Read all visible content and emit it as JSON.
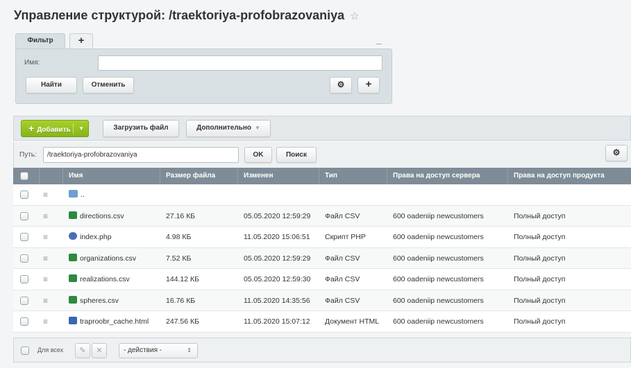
{
  "title": "Управление структурой: /traektoriya-profobrazovaniya",
  "icons": {
    "favorite": "star-icon",
    "settings": "gear-icon",
    "add": "plus-icon",
    "row_menu": "hamburger-icon",
    "edit": "pencil-icon",
    "delete": "close-icon"
  },
  "filter": {
    "tab_label": "Фильтр",
    "add_tab": "+",
    "collapse": "–",
    "name_label": "Имя:",
    "name_value": "",
    "find_label": "Найти",
    "cancel_label": "Отменить",
    "gear": "⚙",
    "plus": "+"
  },
  "toolbar": {
    "add_label": "Добавить",
    "add_plus": "+",
    "upload_label": "Загрузить файл",
    "more_label": "Дополнительно"
  },
  "path": {
    "label": "Путь:",
    "value": "/traektoriya-profobrazovaniya",
    "ok_label": "OK",
    "search_label": "Поиск",
    "gear": "⚙"
  },
  "table": {
    "columns": [
      "Имя",
      "Размер файла",
      "Изменен",
      "Тип",
      "Права на доступ сервера",
      "Права на доступ продукта"
    ],
    "up_row": "..",
    "rows": [
      {
        "name": "directions.csv",
        "size": "27.16 КБ",
        "modified": "05.05.2020 12:59:29",
        "type": "Файл CSV",
        "server": "600 oadeniip newcustomers",
        "product": "Полный доступ"
      },
      {
        "name": "index.php",
        "size": "4.98 КБ",
        "modified": "11.05.2020 15:06:51",
        "type": "Скрипт PHP",
        "server": "600 oadeniip newcustomers",
        "product": "Полный доступ"
      },
      {
        "name": "organizations.csv",
        "size": "7.52 КБ",
        "modified": "05.05.2020 12:59:29",
        "type": "Файл CSV",
        "server": "600 oadeniip newcustomers",
        "product": "Полный доступ"
      },
      {
        "name": "realizations.csv",
        "size": "144.12 КБ",
        "modified": "05.05.2020 12:59:30",
        "type": "Файл CSV",
        "server": "600 oadeniip newcustomers",
        "product": "Полный доступ"
      },
      {
        "name": "spheres.csv",
        "size": "16.76 КБ",
        "modified": "11.05.2020 14:35:56",
        "type": "Файл CSV",
        "server": "600 oadeniip newcustomers",
        "product": "Полный доступ"
      },
      {
        "name": "traproobr_cache.html",
        "size": "247.56 КБ",
        "modified": "11.05.2020 15:07:12",
        "type": "Документ HTML",
        "server": "600 oadeniip newcustomers",
        "product": "Полный доступ"
      }
    ]
  },
  "footer": {
    "all_label": "Для всех",
    "action_value": "- действия -"
  }
}
